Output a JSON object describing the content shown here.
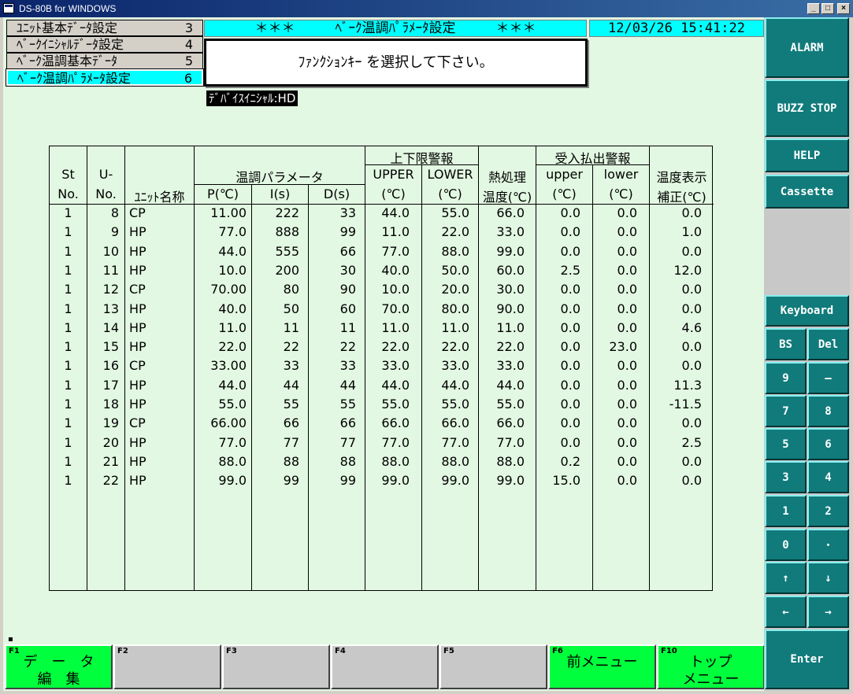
{
  "window": {
    "title": "DS-80B for WINDOWS"
  },
  "menu": {
    "items": [
      {
        "label": "ﾕﾆｯﾄ基本ﾃﾞｰﾀ設定",
        "num": "3"
      },
      {
        "label": "ﾍﾞｰｸｲﾆｼｬﾙﾃﾞｰﾀ設定",
        "num": "4"
      },
      {
        "label": "ﾍﾞｰｸ温調基本ﾃﾞｰﾀ",
        "num": "5"
      },
      {
        "label": "ﾍﾞｰｸ温調ﾊﾟﾗﾒｰﾀ設定",
        "num": "6"
      }
    ]
  },
  "header": {
    "screen_title": "＊＊＊　　　ﾍﾞｰｸ温調ﾊﾟﾗﾒｰﾀ設定　　　＊＊＊",
    "datetime": "12/03/26 15:41:22",
    "message": "ﾌｧﾝｸｼｮﾝｷｰ を選択して下さい。",
    "device": "ﾃﾞﾊﾞｲｽｲﾆｼｬﾙ:HD"
  },
  "table": {
    "headers": {
      "st1": "St",
      "st2": "No.",
      "u1": "U-",
      "u2": "No.",
      "unit": "ﾕﾆｯﾄ名称",
      "temp_param": "温調パラメータ",
      "p": "P(℃)",
      "i": "I(s)",
      "d": "D(s)",
      "limit": "上下限警報",
      "upper": "UPPER",
      "lower": "LOWER",
      "deg1": "(℃)",
      "deg2": "(℃)",
      "heat1": "熱処理",
      "heat2": "温度(℃)",
      "recv": "受入払出警報",
      "upper2": "upper",
      "lower2": "lower",
      "deg3": "(℃)",
      "deg4": "(℃)",
      "disp1": "温度表示",
      "disp2": "補正(℃)"
    },
    "rows": [
      [
        "1",
        "8",
        "CP",
        "11.00",
        "222",
        "33",
        "44.0",
        "55.0",
        "66.0",
        "0.0",
        "0.0",
        "0.0"
      ],
      [
        "1",
        "9",
        "HP",
        "77.0",
        "888",
        "99",
        "11.0",
        "22.0",
        "33.0",
        "0.0",
        "0.0",
        "1.0"
      ],
      [
        "1",
        "10",
        "HP",
        "44.0",
        "555",
        "66",
        "77.0",
        "88.0",
        "99.0",
        "0.0",
        "0.0",
        "0.0"
      ],
      [
        "1",
        "11",
        "HP",
        "10.0",
        "200",
        "30",
        "40.0",
        "50.0",
        "60.0",
        "2.5",
        "0.0",
        "12.0"
      ],
      [
        "1",
        "12",
        "CP",
        "70.00",
        "80",
        "90",
        "10.0",
        "20.0",
        "30.0",
        "0.0",
        "0.0",
        "0.0"
      ],
      [
        "1",
        "13",
        "HP",
        "40.0",
        "50",
        "60",
        "70.0",
        "80.0",
        "90.0",
        "0.0",
        "0.0",
        "0.0"
      ],
      [
        "1",
        "14",
        "HP",
        "11.0",
        "11",
        "11",
        "11.0",
        "11.0",
        "11.0",
        "0.0",
        "0.0",
        "4.6"
      ],
      [
        "1",
        "15",
        "HP",
        "22.0",
        "22",
        "22",
        "22.0",
        "22.0",
        "22.0",
        "0.0",
        "23.0",
        "0.0"
      ],
      [
        "1",
        "16",
        "CP",
        "33.00",
        "33",
        "33",
        "33.0",
        "33.0",
        "33.0",
        "0.0",
        "0.0",
        "0.0"
      ],
      [
        "1",
        "17",
        "HP",
        "44.0",
        "44",
        "44",
        "44.0",
        "44.0",
        "44.0",
        "0.0",
        "0.0",
        "11.3"
      ],
      [
        "1",
        "18",
        "HP",
        "55.0",
        "55",
        "55",
        "55.0",
        "55.0",
        "55.0",
        "0.0",
        "0.0",
        "-11.5"
      ],
      [
        "1",
        "19",
        "CP",
        "66.00",
        "66",
        "66",
        "66.0",
        "66.0",
        "66.0",
        "0.0",
        "0.0",
        "0.0"
      ],
      [
        "1",
        "20",
        "HP",
        "77.0",
        "77",
        "77",
        "77.0",
        "77.0",
        "77.0",
        "0.0",
        "0.0",
        "2.5"
      ],
      [
        "1",
        "21",
        "HP",
        "88.0",
        "88",
        "88",
        "88.0",
        "88.0",
        "88.0",
        "0.2",
        "0.0",
        "0.0"
      ],
      [
        "1",
        "22",
        "HP",
        "99.0",
        "99",
        "99",
        "99.0",
        "99.0",
        "99.0",
        "15.0",
        "0.0",
        "0.0"
      ]
    ]
  },
  "fkeys": [
    {
      "num": "F1",
      "label": "デ　ー　タ\n編　集",
      "active": true
    },
    {
      "num": "F2",
      "label": "",
      "active": false
    },
    {
      "num": "F3",
      "label": "",
      "active": false
    },
    {
      "num": "F4",
      "label": "",
      "active": false
    },
    {
      "num": "F5",
      "label": "",
      "active": false
    },
    {
      "num": "F6",
      "label": "前メニュー",
      "active": true
    },
    {
      "num": "F10",
      "label": "トップ\nメニュー",
      "active": true
    }
  ],
  "side": {
    "alarm": "ALARM",
    "buzz_stop": "BUZZ STOP",
    "help": "HELP",
    "cassette": "Cassette",
    "keyboard": "Keyboard",
    "bs": "BS",
    "del": "Del",
    "k9": "9",
    "kminus": "—",
    "k7": "7",
    "k8": "8",
    "k5": "5",
    "k6": "6",
    "k3": "3",
    "k4": "4",
    "k1": "1",
    "k2": "2",
    "k0": "0",
    "kdot": "･",
    "up": "↑",
    "down": "↓",
    "left": "←",
    "right": "→",
    "enter": "Enter"
  },
  "colors": {
    "background": "#e2f8e2",
    "cyan": "#00ffff",
    "green": "#00ff3c",
    "teal": "#117b7b"
  }
}
